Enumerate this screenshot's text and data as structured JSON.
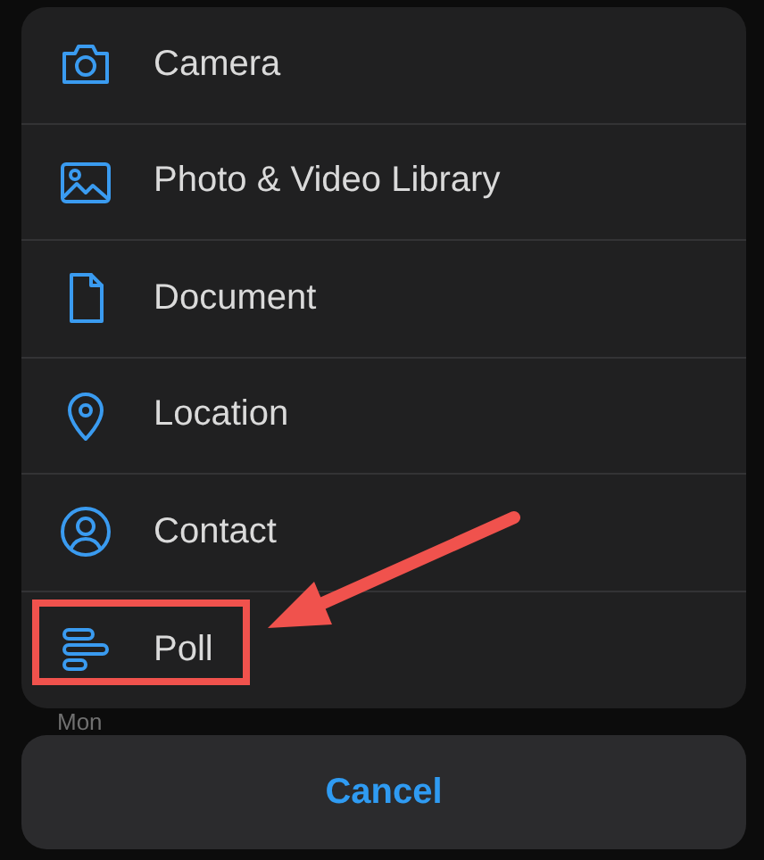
{
  "action_sheet": {
    "items": [
      {
        "kind": "camera",
        "label": "Camera",
        "highlighted": false
      },
      {
        "kind": "photo",
        "label": "Photo & Video Library",
        "highlighted": false
      },
      {
        "kind": "document",
        "label": "Document",
        "highlighted": false
      },
      {
        "kind": "location",
        "label": "Location",
        "highlighted": false
      },
      {
        "kind": "contact",
        "label": "Contact",
        "highlighted": false
      },
      {
        "kind": "poll",
        "label": "Poll",
        "highlighted": true
      }
    ]
  },
  "background": {
    "day": "Mon"
  },
  "cancel": "Cancel"
}
